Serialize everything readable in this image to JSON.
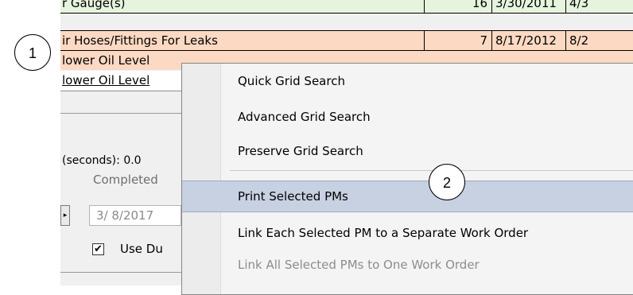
{
  "grid": {
    "rows": [
      {
        "task": "r Gauge(s)",
        "count": "16",
        "date": "3/30/2011",
        "next": "4/3"
      },
      {
        "task": "ir Hoses/Fittings For Leaks",
        "count": "7",
        "date": "8/17/2012",
        "next": "8/2"
      },
      {
        "task": "lower Oil Level",
        "count": "",
        "date": "",
        "next": ""
      },
      {
        "task": "lower Oil Level",
        "count": "",
        "date": "",
        "next": ""
      }
    ]
  },
  "panel": {
    "seconds_label": "(seconds): 0.0",
    "completed_label": "Completed",
    "date_value": "3/ 8/2017",
    "use_due_label": "Use Du",
    "spinner_glyph": "▸",
    "check_mark": "✔"
  },
  "context_menu": {
    "items": [
      {
        "label": "Quick Grid Search",
        "state": "normal"
      },
      {
        "label": "Advanced Grid Search",
        "state": "normal"
      },
      {
        "label": "Preserve Grid Search",
        "state": "normal"
      },
      {
        "label": "Print Selected PMs",
        "state": "highlighted"
      },
      {
        "label": "Link Each Selected PM to a Separate Work Order",
        "state": "normal"
      },
      {
        "label": "Link All Selected PMs to One Work Order",
        "state": "disabled"
      }
    ]
  },
  "callouts": {
    "one": "1",
    "two": "2"
  },
  "colors": {
    "row_highlight": "#fcd9c2",
    "row_top": "#e6f4dd",
    "menu_highlight": "#c7d1e2",
    "menu_disabled_text": "#8d8d8d"
  }
}
